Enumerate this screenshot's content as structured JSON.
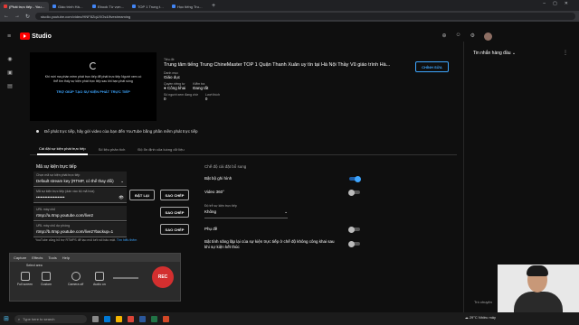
{
  "browser": {
    "tabs": [
      {
        "label": "(Phát trực tiếp - YouTube Studio",
        "active": true
      },
      {
        "label": "Giáo trình Hán ngữ ChineMaster",
        "active": false
      },
      {
        "label": "Ebook Từ vựng tiếng Trung Thư",
        "active": false
      },
      {
        "label": "TOP 1 Trung tâm tiếng Trung",
        "active": false
      },
      {
        "label": "Học tiếng Trung Nguyễn Minh Vũ",
        "active": false
      }
    ],
    "url": "studio.youtube.com/video/HNF8ZqUXOs4/livestreaming"
  },
  "studio": {
    "brand": "Studio"
  },
  "preview": {
    "message": "Khi mời ma phần mềm phát trực tiếp để phát trực tiếp Người xem có thể tìm thấy sự kiện phát trực tiếp sau khi bạn phát sóng",
    "link": "TRỢ GIÚP TẠO SỰ KIỆN PHÁT TRỰC TIẾP"
  },
  "details": {
    "title_label": "Tiêu đề",
    "title": "Trung tâm tiếng Trung ChineMaster TOP 1 Quận Thanh Xuân uy tín tại Hà Nội Thầy Vũ giáo trình Hà...",
    "category_label": "Danh mục",
    "category": "Giáo dục",
    "privacy_label": "Quyền riêng tư",
    "privacy": "Công khai",
    "status_label": "Kiểm tra",
    "status": "Đang tắt",
    "viewers_label": "Số người xem đang chờ",
    "viewers": "0",
    "likes_label": "Lượt thích",
    "likes": "0",
    "edit_button": "CHỈNH SỬA"
  },
  "note": "Để phát trực tiếp, hãy gửi video của bạn đến YouTube bằng phần mềm phát trực tiếp",
  "tabs": [
    "Cài đặt sự kiện phát trực tiếp",
    "Số liệu phân tích",
    "Độ ổn định của luồng dữ liệu"
  ],
  "stream": {
    "heading": "Mã sự kiện trực tiếp",
    "key_type_label": "Chọn mã sự kiện phát trực tiếp",
    "key_type": "Default stream key (RTMP, có thể thay đổi)",
    "key_label": "Mã sự kiện trực tiếp (dán vào bộ mã hóa)",
    "key_value": "••••••••••••••••••••",
    "reset_button": "ĐẶT LẠI",
    "copy_button": "SAO CHÉP",
    "url_label": "URL máy chủ",
    "url_value": "rtmp://a.rtmp.youtube.com/live2",
    "backup_label": "URL máy chủ dự phòng",
    "backup_value": "rtmp://b.rtmp.youtube.com/live2?backup=1",
    "hint": "YouTube cũng hỗ trợ RTMPS để tạo mối kết nối bảo mật.",
    "hint_link": "Tìm hiểu thêm"
  },
  "settings": {
    "heading": "Chế độ cài đặt bổ sung",
    "dvr": "Bật bộ ghi hình",
    "video360": "Video 360°",
    "latency_label": "Độ trễ sự kiện trực tiếp",
    "latency": "Không",
    "captions": "Phụ đề",
    "unlisted_end": "Bật tính năng lặp lại của sự kiện trực tiếp ở chế độ không công khai sau khi sự kiện kết thúc"
  },
  "chat": {
    "header": "Tin nhắn hàng đầu",
    "input_hint": "Trò chuyện"
  },
  "recorder": {
    "menu": [
      "Capture",
      "Effects",
      "Tools",
      "Help"
    ],
    "select_area": "Select area",
    "tools": [
      "Full screen",
      "Custom",
      "Camera off",
      "Audio on"
    ],
    "rec_label": "REC"
  },
  "taskbar": {
    "search": "Type here to search",
    "weather": "29°C Nhiều mây"
  }
}
